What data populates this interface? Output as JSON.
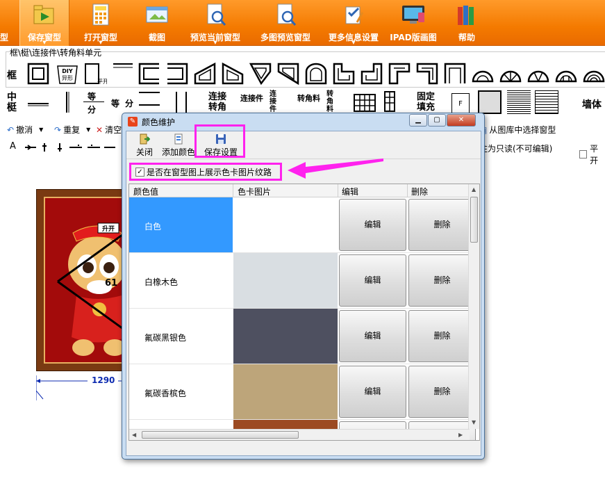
{
  "ribbon": {
    "items": [
      {
        "label": "型",
        "icon": "window-icon"
      },
      {
        "label": "保存窗型",
        "icon": "save-folder-icon"
      },
      {
        "label": "打开窗型",
        "icon": "calculator-icon"
      },
      {
        "label": "截图",
        "icon": "screenshot-icon"
      },
      {
        "label": "预览当前窗型",
        "icon": "preview-document-icon"
      },
      {
        "label": "多图预览窗型",
        "icon": "multi-preview-icon"
      },
      {
        "label": "更多信息设置",
        "icon": "settings-edit-icon"
      },
      {
        "label": "IPAD版画图",
        "icon": "ipad-icon"
      },
      {
        "label": "帮助",
        "icon": "books-icon"
      }
    ]
  },
  "breadcrumb": "框\\梃\\连接件\\转角料单元",
  "row_labels": {
    "frame": "框",
    "mullion": "中\n梃"
  },
  "shape_texts": {
    "diy": "DIY\n异形",
    "flat": "平开",
    "equal": "等",
    "divide": "分",
    "equal_divide": "等分",
    "connector": "连接\n转角",
    "connector_piece": "连接件",
    "connector_piece_v": "连接件",
    "corner_material": "转角料",
    "corner_material_v": "转角料",
    "fixed_fill": "固定\n填充",
    "f_label": "F",
    "wall": "墙体"
  },
  "toolbar": {
    "undo": "撤消",
    "redo": "重复",
    "clear": "清空",
    "select_from_lib": "从图库中选择窗型",
    "readonly": "注为只读(不可编辑)",
    "flat_open": "平开",
    "text_tool": "A"
  },
  "drawing": {
    "dimension": "1290",
    "banner": "升开",
    "sash_label": "61"
  },
  "dialog": {
    "title": "颜色维护",
    "tools": [
      {
        "label": "关闭",
        "icon": "exit-icon"
      },
      {
        "label": "添加颜色",
        "icon": "add-color-icon"
      },
      {
        "label": "保存设置",
        "icon": "floppy-save-icon"
      }
    ],
    "show_texture_label": "是否在窗型图上展示色卡图片纹路",
    "show_texture_checked": true,
    "columns": [
      "颜色值",
      "色卡图片",
      "编辑",
      "删除"
    ],
    "rows": [
      {
        "name": "白色",
        "swatch": "#ffffff",
        "selected": true,
        "edit": "编辑",
        "delete": "删除"
      },
      {
        "name": "白橡木色",
        "swatch": "#d9dee2",
        "selected": false,
        "edit": "编辑",
        "delete": "删除"
      },
      {
        "name": "氟碳黑银色",
        "swatch": "#4e5060",
        "selected": false,
        "edit": "编辑",
        "delete": "删除"
      },
      {
        "name": "氟碳香槟色",
        "swatch": "#bda57a",
        "selected": false,
        "edit": "编辑",
        "delete": "删除"
      },
      {
        "name": "...",
        "swatch": "#9c4a22",
        "selected": false,
        "edit": "编辑",
        "delete": "删除"
      }
    ]
  },
  "colors": {
    "ribbon": "#f47a00",
    "selection": "#3399ff",
    "highlight": "#ff22ee",
    "dimension": "#0d2bb0"
  }
}
